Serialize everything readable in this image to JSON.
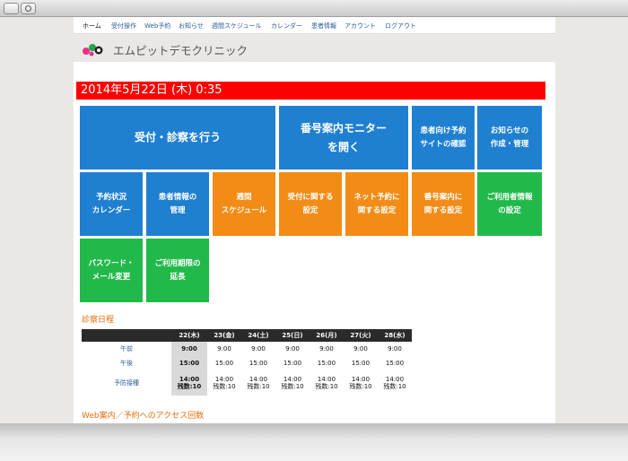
{
  "nav": {
    "items": [
      "ホーム",
      "受付操作",
      "Web予約",
      "お知らせ",
      "週間スケジュール",
      "カレンダー",
      "患者情報",
      "アカウント",
      "ログアウト"
    ]
  },
  "header": {
    "clinic_name": "エムピットデモクリニック"
  },
  "date_bar": "2014年5月22日 (木) 0:35",
  "tiles": {
    "reception": "受付・診察を行う",
    "queue_monitor": "番号案内モニター\nを開く",
    "patient_booking_site": "患者向け予約\nサイトの確認",
    "notice_create": "お知らせの\n作成・管理",
    "booking_calendar": "予約状況\nカレンダー",
    "patient_info": "患者情報の\n管理",
    "weekly_schedule": "週間\nスケジュール",
    "reception_settings": "受付に関する\n設定",
    "net_booking_settings": "ネット予約に\n関する設定",
    "queue_settings": "番号案内に\n関する設定",
    "user_info_settings": "ご利用者情報\nの設定",
    "password_mail": "パスワード・\nメール変更",
    "extend_period": "ご利用期限の\n延長"
  },
  "schedule": {
    "title": "診察日程",
    "headers": [
      "",
      "22(木)",
      "23(金)",
      "24(土)",
      "25(日)",
      "26(月)",
      "27(火)",
      "28(水)"
    ],
    "rows": [
      {
        "label": "午前",
        "cells": [
          "9:00",
          "9:00",
          "9:00",
          "9:00",
          "9:00",
          "9:00",
          "9:00"
        ]
      },
      {
        "label": "午後",
        "cells": [
          "15:00",
          "15:00",
          "15:00",
          "15:00",
          "15:00",
          "15:00",
          "15:00"
        ]
      },
      {
        "label": "予防接種",
        "cells": [
          "14:00\n残数:10",
          "14:00\n残数:10",
          "14:00\n残数:10",
          "14:00\n残数:10",
          "14:00\n残数:10",
          "14:00\n残数:10",
          "14:00\n残数:10"
        ]
      }
    ]
  },
  "access_title": "Web案内／予約へのアクセス回数",
  "colors": {
    "blue": "#1f80d2",
    "orange": "#f28c17",
    "green": "#22b94b",
    "date_bar": "#ff0000",
    "section_title": "#e36c09"
  }
}
